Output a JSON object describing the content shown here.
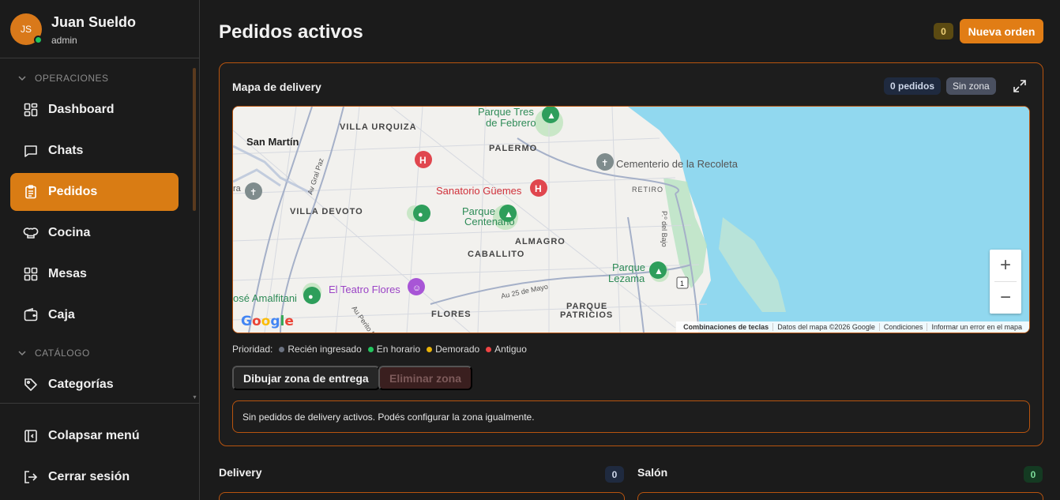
{
  "user": {
    "initials": "JS",
    "name": "Juan Sueldo",
    "role": "admin"
  },
  "sidebar": {
    "section_operaciones": "OPERACIONES",
    "section_catalogo": "CATÁLOGO",
    "items": [
      {
        "label": "Dashboard",
        "icon": "dashboard-icon"
      },
      {
        "label": "Chats",
        "icon": "chat-icon"
      },
      {
        "label": "Pedidos",
        "icon": "clipboard-icon",
        "active": true
      },
      {
        "label": "Cocina",
        "icon": "chef-hat-icon"
      },
      {
        "label": "Mesas",
        "icon": "grid-icon"
      },
      {
        "label": "Caja",
        "icon": "wallet-icon"
      },
      {
        "label": "Categorías",
        "icon": "tag-icon"
      }
    ],
    "collapse_label": "Colapsar menú",
    "logout_label": "Cerrar sesión"
  },
  "header": {
    "title": "Pedidos activos",
    "count": "0",
    "new_order_label": "Nueva orden"
  },
  "delivery_map": {
    "title": "Mapa de delivery",
    "orders_pill": "0 pedidos",
    "zone_pill": "Sin zona",
    "map_labels": {
      "villa_urquiza": "VILLA URQUIZA",
      "san_martin": "San Martín",
      "palermo": "PALERMO",
      "parque_tres": "Parque Tres",
      "de_febrero": "de Febrero",
      "cementerio": "Cementerio de la Recoleta",
      "retiro": "RETIRO",
      "sanatorio": "Sanatorio Güemes",
      "villa_devoto": "VILLA DEVOTO",
      "parque": "Parque",
      "centenario": "Centenario",
      "almagro": "ALMAGRO",
      "caballito": "CABALLITO",
      "parque_lezama": "Parque",
      "lezama": "Lezama",
      "teatro_flores": "El Teatro Flores",
      "amalfitani": "osé Amalfitani",
      "au_25_mayo": "Au 25 de Mayo",
      "parque_patricios_1": "PARQUE",
      "parque_patricios_2": "PATRICIOS",
      "flores": "FLORES",
      "av_gral_paz": "Av Gral Paz",
      "au_perito": "Au Perito Mo",
      "pso_bajo": "P.º del Bajo",
      "ra": "ra",
      "route_1": "1"
    },
    "zoom_in": "+",
    "zoom_out": "−",
    "google": "Google",
    "attribution": {
      "shortcuts": "Combinaciones de teclas",
      "data": "Datos del mapa ©2026 Google",
      "terms": "Condiciones",
      "report": "Informar un error en el mapa"
    },
    "legend": {
      "label": "Prioridad:",
      "items": [
        {
          "label": "Recién ingresado",
          "color": "#6b7280"
        },
        {
          "label": "En horario",
          "color": "#22c55e"
        },
        {
          "label": "Demorado",
          "color": "#eab308"
        },
        {
          "label": "Antiguo",
          "color": "#ef4444"
        }
      ]
    },
    "draw_zone_label": "Dibujar zona de entrega",
    "delete_zone_label": "Eliminar zona",
    "empty_message": "Sin pedidos de delivery activos. Podés configurar la zona igualmente."
  },
  "delivery": {
    "title": "Delivery",
    "count": "0"
  },
  "salon": {
    "title": "Salón",
    "count": "0"
  }
}
